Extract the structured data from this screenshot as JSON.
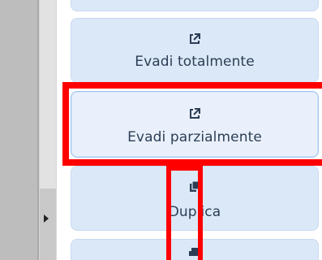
{
  "buttons": {
    "evadi_totalmente": {
      "label": "Evadi totalmente",
      "icon": "external-link-icon"
    },
    "evadi_parzialmente": {
      "label": "Evadi parzialmente",
      "icon": "external-link-icon"
    },
    "duplica": {
      "label": "Duplica",
      "icon": "copy-icon"
    },
    "next": {
      "icon": "print-icon"
    }
  },
  "colors": {
    "button_bg": "#dbe8f8",
    "button_selected_bg": "#e9f0fb",
    "button_text": "#2c3e55",
    "annotation": "#ff0000"
  }
}
